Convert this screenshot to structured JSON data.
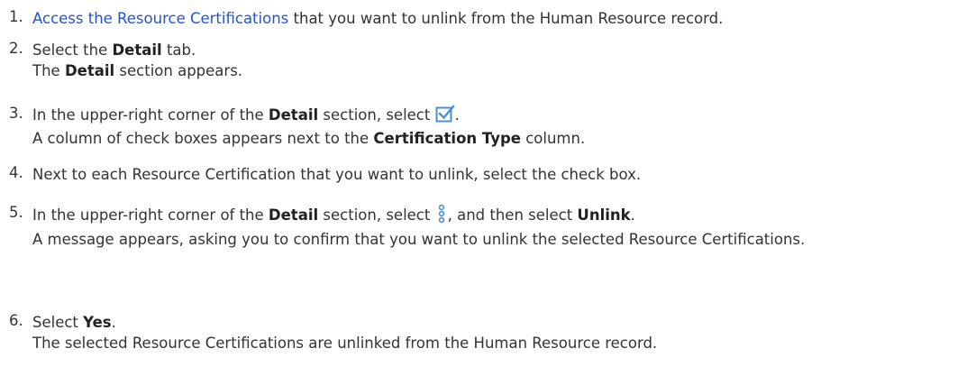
{
  "steps": [
    {
      "number": "1.",
      "link": "Access the Resource Certifications",
      "text": " that you want to unlink from the Human Resource record."
    },
    {
      "number": "2.",
      "pre": "Select the ",
      "bold": "Detail",
      "post": " tab.",
      "result_pre": "The ",
      "result_bold": "Detail",
      "result_post": " section appears."
    },
    {
      "number": "3.",
      "pre": "In the upper-right corner of the ",
      "bold": "Detail",
      "mid": " section, select ",
      "icon": "checkbox-select-icon",
      "post": ".",
      "result_pre": "A column of check boxes appears next to the ",
      "result_bold": "Certification Type",
      "result_post": " column."
    },
    {
      "number": "4.",
      "text": "Next to each Resource Certification that you want to unlink, select the check box."
    },
    {
      "number": "5.",
      "pre": "In the upper-right corner of the ",
      "bold": "Detail",
      "mid": " section, select ",
      "icon": "more-options-icon",
      "mid2": ", and then select ",
      "bold2": "Unlink",
      "post": ".",
      "result": "A message appears, asking you to confirm that you want to unlink the selected Resource Certifications."
    },
    {
      "number": "6.",
      "pre": "Select ",
      "bold": "Yes",
      "post": ".",
      "result": "The selected Resource Certifications are unlinked from the Human Resource record."
    }
  ],
  "colors": {
    "link": "#2255cc",
    "text": "#333333",
    "icon_blue": "#4a8fd6"
  }
}
